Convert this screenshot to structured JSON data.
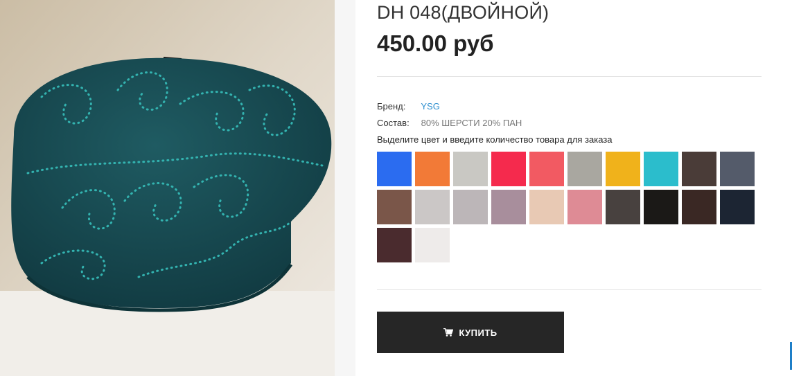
{
  "product": {
    "title": "DH 048(ДВОЙНОЙ)",
    "price": "450.00 руб",
    "brand_label": "Бренд:",
    "brand": "YSG",
    "composition_label": "Состав:",
    "composition": "80% ШЕРСТИ 20% ПАН",
    "color_hint": "Выделите цвет и введите количество товара для заказа",
    "buy_label": "КУПИТЬ",
    "image_icon": "beret-photo"
  },
  "swatches": [
    "#2b6cf0",
    "#f27a37",
    "#c9c8c3",
    "#f52a4d",
    "#f25a62",
    "#a9a7a0",
    "#f0b21b",
    "#2bbdcc",
    "#4a3c38",
    "#545b6a",
    "#7a5649",
    "#cbc7c6",
    "#bcb6b8",
    "#a88e9c",
    "#e8c9b4",
    "#de8b95",
    "#48413f",
    "#1b1917",
    "#3a2824",
    "#1c2533",
    "#4a2b2e",
    "#eeebea"
  ],
  "colors": {
    "accent": "#2e8fcf",
    "button_bg": "#262626",
    "hat": "#17464e",
    "stones": "#2fb6b3"
  }
}
